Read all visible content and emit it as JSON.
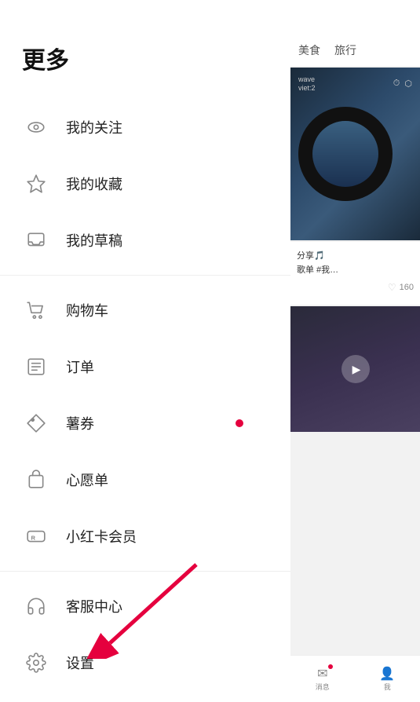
{
  "menu": {
    "title": "更多",
    "items": [
      {
        "id": "follow",
        "label": "我的关注",
        "icon": "eye",
        "dot": false,
        "divider_after": false
      },
      {
        "id": "favorite",
        "label": "我的收藏",
        "icon": "star",
        "dot": false,
        "divider_after": false
      },
      {
        "id": "draft",
        "label": "我的草稿",
        "icon": "inbox",
        "dot": false,
        "divider_after": true
      },
      {
        "id": "cart",
        "label": "购物车",
        "icon": "cart",
        "dot": false,
        "divider_after": false
      },
      {
        "id": "order",
        "label": "订单",
        "icon": "list",
        "dot": false,
        "divider_after": false
      },
      {
        "id": "coupon",
        "label": "薯券",
        "icon": "tag",
        "dot": true,
        "divider_after": false
      },
      {
        "id": "wishlist",
        "label": "心愿单",
        "icon": "bag",
        "dot": false,
        "divider_after": false
      },
      {
        "id": "vip",
        "label": "小红卡会员",
        "icon": "vip",
        "dot": false,
        "divider_after": true
      },
      {
        "id": "support",
        "label": "客服中心",
        "icon": "headset",
        "dot": false,
        "divider_after": false
      },
      {
        "id": "settings",
        "label": "设置",
        "icon": "gear",
        "dot": false,
        "divider_after": false
      }
    ]
  },
  "right_panel": {
    "tabs": [
      "美食",
      "旅行"
    ],
    "card1": {
      "top_label1": "wave",
      "top_label2": "viet:2"
    },
    "card2": {
      "text_line1": "分享🎵",
      "text_line2": "歌单 #我…",
      "like_count": "160"
    },
    "bottom_nav": {
      "items": [
        "消息",
        "我"
      ]
    }
  }
}
